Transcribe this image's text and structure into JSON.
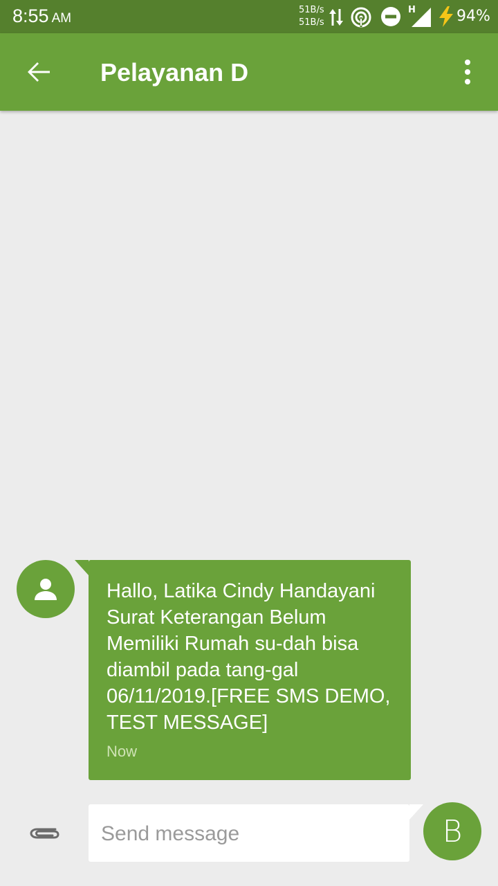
{
  "status_bar": {
    "time": "8:55",
    "ampm": "AM",
    "net_up": "51B/s",
    "net_down": "51B/s",
    "network_type": "H",
    "battery": "94%",
    "icons": [
      "data-transfer-icon",
      "hotspot-icon",
      "do-not-disturb-icon",
      "signal-icon",
      "charging-icon"
    ]
  },
  "app_bar": {
    "title": "Pelayanan D",
    "back_icon": "arrow-back-icon",
    "menu_icon": "more-vert-icon"
  },
  "conversation": {
    "messages": [
      {
        "text": "Hallo, Latika Cindy Handayani Surat Keterangan Belum Memiliki Rumah su-dah bisa diambil pada tang-gal 06/11/2019.[FREE SMS DEMO, TEST MESSAGE]",
        "time": "Now",
        "avatar_icon": "person-icon"
      }
    ]
  },
  "composer": {
    "placeholder": "Send message",
    "attach_icon": "paperclip-icon",
    "send_label": "B"
  },
  "colors": {
    "status_bar": "#55802d",
    "primary": "#6aa23a",
    "background": "#ececec"
  }
}
